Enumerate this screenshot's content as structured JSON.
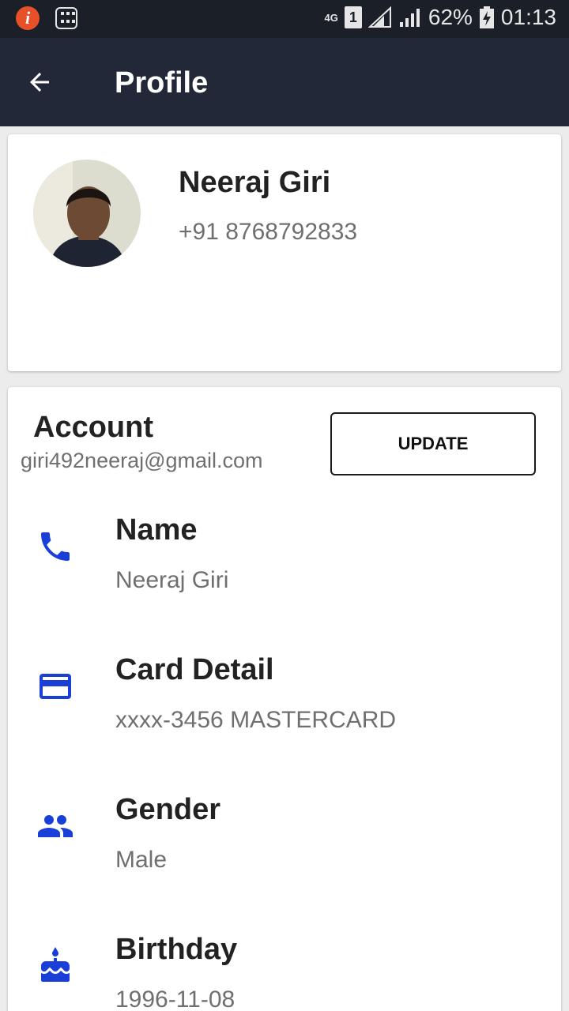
{
  "status_bar": {
    "network": "4G",
    "sim": "1",
    "battery": "62%",
    "time": "01:13"
  },
  "app_bar": {
    "title": "Profile"
  },
  "profile": {
    "name": "Neeraj Giri",
    "phone": "+91 8768792833"
  },
  "account": {
    "title": "Account",
    "email": "giri492neeraj@gmail.com",
    "update_label": "UPDATE",
    "fields": [
      {
        "label": "Name",
        "value": "Neeraj Giri",
        "icon": "phone-icon"
      },
      {
        "label": "Card Detail",
        "value": "xxxx-3456 MASTERCARD",
        "icon": "credit-card-icon"
      },
      {
        "label": "Gender",
        "value": "Male",
        "icon": "people-icon"
      },
      {
        "label": "Birthday",
        "value": "1996-11-08",
        "icon": "cake-icon"
      }
    ]
  },
  "colors": {
    "accent": "#1a3fd8",
    "app_bar": "#232838",
    "status_bar": "#1b1f27"
  }
}
